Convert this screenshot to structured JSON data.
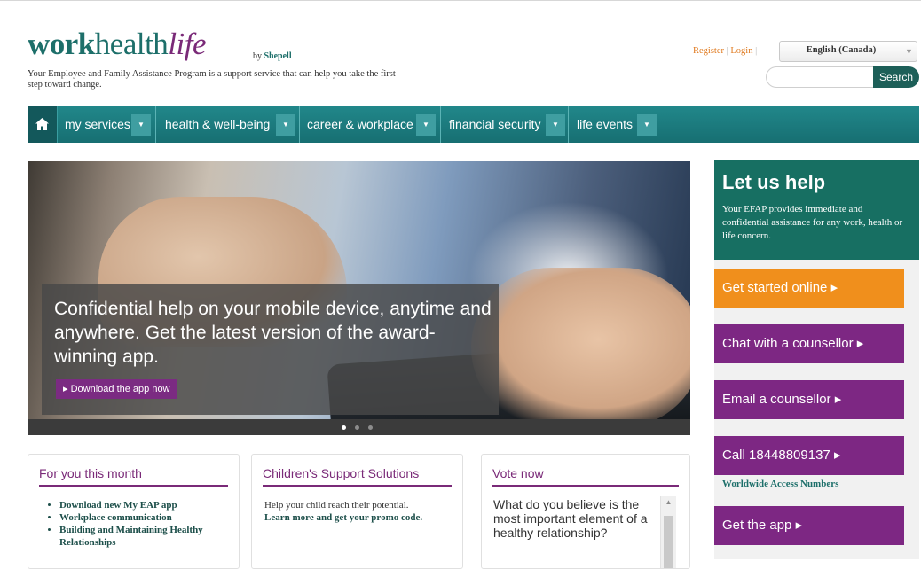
{
  "brand": {
    "logo_work": "work",
    "logo_health": "health",
    "logo_life": "life",
    "byline_prefix": "by",
    "byline_name": "Shepell",
    "tagline": "Your Employee and Family Assistance Program is a support service that can help you take the first step toward change."
  },
  "top": {
    "register": "Register",
    "login": "Login",
    "separator": "|",
    "language": "English (Canada)",
    "search_button": "Search"
  },
  "nav": {
    "items": [
      {
        "label": "my services"
      },
      {
        "label": "health & well-being"
      },
      {
        "label": "career & workplace"
      },
      {
        "label": "financial security"
      },
      {
        "label": "life events"
      }
    ]
  },
  "hero": {
    "caption": "Confidential help on your mobile device, anytime and anywhere. Get the latest version of the award-winning app.",
    "button": "Download the app now",
    "slide_count": 3,
    "active_slide": 1
  },
  "sidebar": {
    "title": "Let us help",
    "description": "Your EFAP provides immediate and confidential assistance for any work, health or life concern.",
    "actions": [
      {
        "label": "Get started online",
        "color": "#f08f1c"
      },
      {
        "label": "Chat with a counsellor",
        "color": "#7d2783"
      },
      {
        "label": "Email a counsellor",
        "color": "#7d2783"
      },
      {
        "label": "Call 18448809137",
        "color": "#7d2783"
      },
      {
        "label": "Get the app",
        "color": "#7d2783"
      }
    ],
    "worldwide": "Worldwide Access Numbers"
  },
  "boxes": {
    "month": {
      "title": "For you this month",
      "items": [
        "Download new My EAP app",
        "Workplace communication",
        "Building and Maintaining Healthy Relationships"
      ]
    },
    "children": {
      "title": "Children's Support Solutions",
      "text": "Help your child reach their potential.",
      "link": "Learn more and get your promo code."
    },
    "vote": {
      "title": "Vote now",
      "question": "What do you believe is the most important element of a healthy relationship?"
    }
  },
  "icons": {
    "home": "home-icon",
    "dropdown": "chevron-down-icon",
    "arrow": "triangle-right-icon"
  },
  "colors": {
    "teal": "#1d6f6a",
    "purple": "#7d2783",
    "orange": "#f08f1c",
    "nav": "#1b7c7f"
  }
}
